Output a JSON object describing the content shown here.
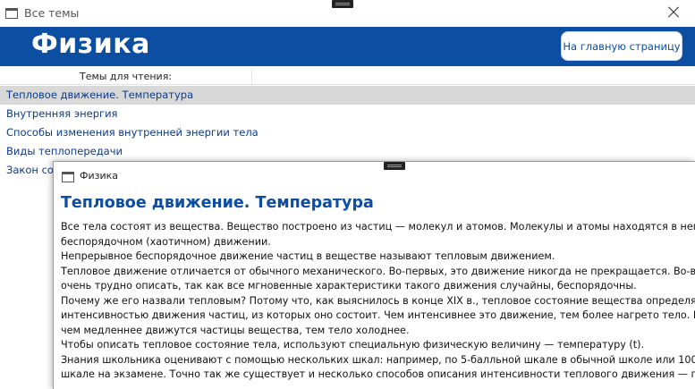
{
  "main_window": {
    "title": "Все темы",
    "logo": "Физика",
    "home_button": "На главную страницу",
    "column_header": "Темы для чтения:",
    "topics": [
      "Тепловое движение. Температура",
      "Внутренняя энергия",
      "Способы изменения внутренней энергии тела",
      "Виды теплопередачи",
      "Закон сох"
    ],
    "selected_topic_index": 0
  },
  "article_window": {
    "title": "Физика",
    "heading": "Тепловое движение. Температура",
    "lines": [
      "Все тела состоят из вещества. Вещество построено из частиц — молекул и атомов. Молекулы и атомы находятся в непрер",
      "беспорядочном (хаотичном) движении.",
      "Непрерывное беспорядочное движение частиц в веществе называют тепловым движением.",
      "Тепловое движение отличается от обычного механического. Во-первых, это движение никогда не прекращается. Во-вторых",
      "очень трудно описать, так как все мгновенные характеристики такого движения случайны, беспорядочны.",
      "Почему же его назвали тепловым? Потому что, как выяснилось в конце XIX в., тепловое состояние вещества определяется",
      "интенсивностью движения частиц, из которых оно состоит. Чем интенсивнее это движение, тем более нагрето тело. И наоб",
      "чем медленнее движутся частицы вещества, тем тело холоднее.",
      "Чтобы описать тепловое состояние тела, используют специальную физическую величину — температуру (t).",
      "Знания школьника оценивают с помощью нескольких шкал: например, по 5-балльной шкале в обычной школе или 100-б",
      "шкале на экзамене. Точно так же существует и несколько способов описания интенсивности теплового движения — прим"
    ]
  },
  "colors": {
    "brand_blue": "#0c4ea1",
    "selected_row": "#d8d8d8"
  }
}
